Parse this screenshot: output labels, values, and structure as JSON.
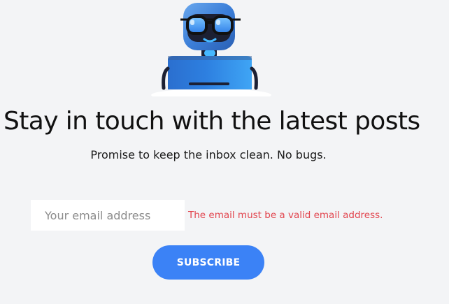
{
  "newsletter": {
    "headline": "Stay in touch with the latest posts",
    "subline": "Promise to keep the inbox clean. No bugs.",
    "email_placeholder": "Your email address",
    "error_message": "The email must be a valid email address.",
    "subscribe_label": "SUBSCRIBE"
  },
  "icons": {
    "mascot": "robot-with-glasses-illustration"
  },
  "colors": {
    "background": "#f3f4f6",
    "accent": "#3b82f6",
    "error": "#e2464f",
    "robot_blue": "#2f7fd6",
    "robot_dark": "#1c2033"
  }
}
